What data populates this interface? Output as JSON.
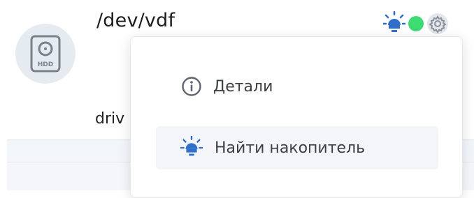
{
  "disk": {
    "title": "/dev/vdf",
    "avatar_icon": "hdd-icon",
    "avatar_text": "HDD",
    "row_label": "driv"
  },
  "status": {
    "locate_icon": "lightbulb-icon",
    "led_color": "#3ddc72",
    "settings_icon": "gear-icon"
  },
  "menu": {
    "items": [
      {
        "label": "Детали",
        "icon": "info-circle-icon"
      },
      {
        "label": "Найти накопитель",
        "icon": "lightbulb-icon"
      }
    ]
  },
  "colors": {
    "accent_blue": "#2f6fc9",
    "icon_gray": "#7a818b"
  }
}
